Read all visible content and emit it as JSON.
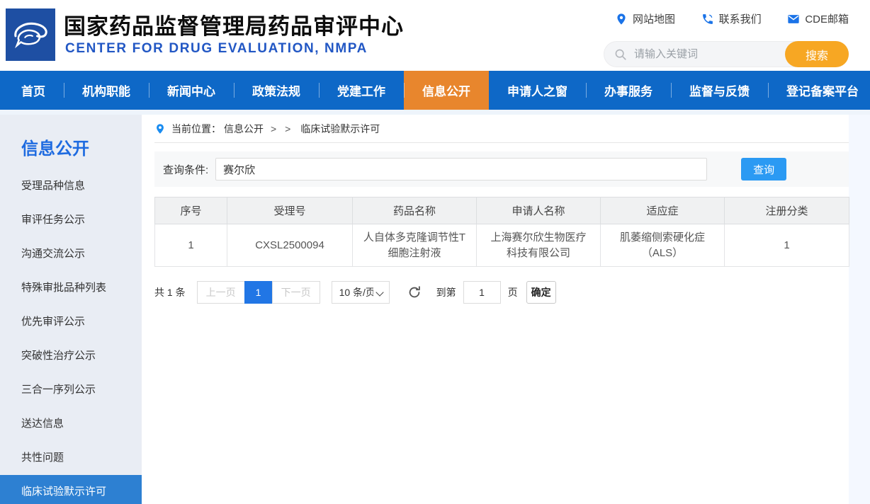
{
  "header": {
    "site_title": "国家药品监督管理局药品审评中心",
    "site_subtitle": "CENTER FOR DRUG EVALUATION, NMPA",
    "links": [
      {
        "icon": "location-pin-icon",
        "label": "网站地图"
      },
      {
        "icon": "phone-icon",
        "label": "联系我们"
      },
      {
        "icon": "mail-icon",
        "label": "CDE邮箱"
      }
    ],
    "search": {
      "placeholder": "请输入关键词",
      "button": "搜索"
    }
  },
  "nav": {
    "items": [
      {
        "label": "首页",
        "active": false
      },
      {
        "label": "机构职能",
        "active": false
      },
      {
        "label": "新闻中心",
        "active": false
      },
      {
        "label": "政策法规",
        "active": false
      },
      {
        "label": "党建工作",
        "active": false
      },
      {
        "label": "信息公开",
        "active": true
      },
      {
        "label": "申请人之窗",
        "active": false
      },
      {
        "label": "办事服务",
        "active": false
      },
      {
        "label": "监督与反馈",
        "active": false
      },
      {
        "label": "登记备案平台",
        "active": false
      }
    ]
  },
  "sidebar": {
    "title": "信息公开",
    "items": [
      {
        "label": "受理品种信息",
        "active": false
      },
      {
        "label": "审评任务公示",
        "active": false
      },
      {
        "label": "沟通交流公示",
        "active": false
      },
      {
        "label": "特殊审批品种列表",
        "active": false
      },
      {
        "label": "优先审评公示",
        "active": false
      },
      {
        "label": "突破性治疗公示",
        "active": false
      },
      {
        "label": "三合一序列公示",
        "active": false
      },
      {
        "label": "送达信息",
        "active": false
      },
      {
        "label": "共性问题",
        "active": false
      },
      {
        "label": "临床试验默示许可",
        "active": true
      }
    ]
  },
  "breadcrumb": {
    "label": "当前位置：",
    "section": "信息公开",
    "separator": "> >",
    "current": "临床试验默示许可"
  },
  "query": {
    "label": "查询条件:",
    "value": "赛尔欣",
    "button": "查询"
  },
  "table": {
    "headers": [
      "序号",
      "受理号",
      "药品名称",
      "申请人名称",
      "适应症",
      "注册分类"
    ],
    "rows": [
      [
        "1",
        "CXSL2500094",
        "人自体多克隆调节性T细胞注射液",
        "上海赛尔欣生物医疗科技有限公司",
        "肌萎缩侧索硬化症（ALS）",
        "1"
      ]
    ]
  },
  "pagination": {
    "total": "共 1 条",
    "prev": "上一页",
    "current_page": "1",
    "next": "下一页",
    "page_size": "10 条/页",
    "goto_label": "到第",
    "goto_value": "1",
    "page_word": "页",
    "confirm": "确定"
  },
  "colors": {
    "nav_blue": "#0e68c7",
    "active_orange": "#e8862d",
    "search_orange": "#f7a723",
    "sidebar_bg": "#e9edf4",
    "sidebar_active_blue": "#2d80d2",
    "query_button_blue": "#2b9af3",
    "pager_active_blue": "#2176e5",
    "subtitle_blue": "#2257c4",
    "link_icon_blue": "#1a73e8"
  }
}
